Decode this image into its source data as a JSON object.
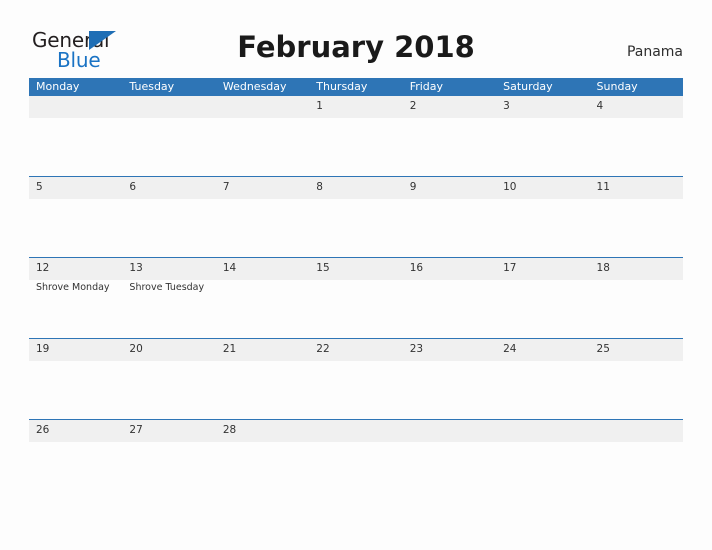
{
  "brand": {
    "line1": "General",
    "line2": "Blue",
    "flag_icon": "triangle-flag-icon",
    "color_dark": "#231f20",
    "color_blue": "#1a73c4"
  },
  "header": {
    "title": "February 2018",
    "country": "Panama"
  },
  "theme": {
    "header_blue": "#2e75b6",
    "band_gray": "#f0f0f0",
    "page_background": "#fdfdfd",
    "text": "#333333"
  },
  "calendar": {
    "month": "February",
    "year": "2018",
    "weekday_headers": [
      "Monday",
      "Tuesday",
      "Wednesday",
      "Thursday",
      "Friday",
      "Saturday",
      "Sunday"
    ],
    "weeks": [
      [
        {
          "day": "",
          "event": ""
        },
        {
          "day": "",
          "event": ""
        },
        {
          "day": "",
          "event": ""
        },
        {
          "day": "1",
          "event": ""
        },
        {
          "day": "2",
          "event": ""
        },
        {
          "day": "3",
          "event": ""
        },
        {
          "day": "4",
          "event": ""
        }
      ],
      [
        {
          "day": "5",
          "event": ""
        },
        {
          "day": "6",
          "event": ""
        },
        {
          "day": "7",
          "event": ""
        },
        {
          "day": "8",
          "event": ""
        },
        {
          "day": "9",
          "event": ""
        },
        {
          "day": "10",
          "event": ""
        },
        {
          "day": "11",
          "event": ""
        }
      ],
      [
        {
          "day": "12",
          "event": "Shrove Monday"
        },
        {
          "day": "13",
          "event": "Shrove Tuesday"
        },
        {
          "day": "14",
          "event": ""
        },
        {
          "day": "15",
          "event": ""
        },
        {
          "day": "16",
          "event": ""
        },
        {
          "day": "17",
          "event": ""
        },
        {
          "day": "18",
          "event": ""
        }
      ],
      [
        {
          "day": "19",
          "event": ""
        },
        {
          "day": "20",
          "event": ""
        },
        {
          "day": "21",
          "event": ""
        },
        {
          "day": "22",
          "event": ""
        },
        {
          "day": "23",
          "event": ""
        },
        {
          "day": "24",
          "event": ""
        },
        {
          "day": "25",
          "event": ""
        }
      ],
      [
        {
          "day": "26",
          "event": ""
        },
        {
          "day": "27",
          "event": ""
        },
        {
          "day": "28",
          "event": ""
        },
        {
          "day": "",
          "event": ""
        },
        {
          "day": "",
          "event": ""
        },
        {
          "day": "",
          "event": ""
        },
        {
          "day": "",
          "event": ""
        }
      ]
    ]
  }
}
